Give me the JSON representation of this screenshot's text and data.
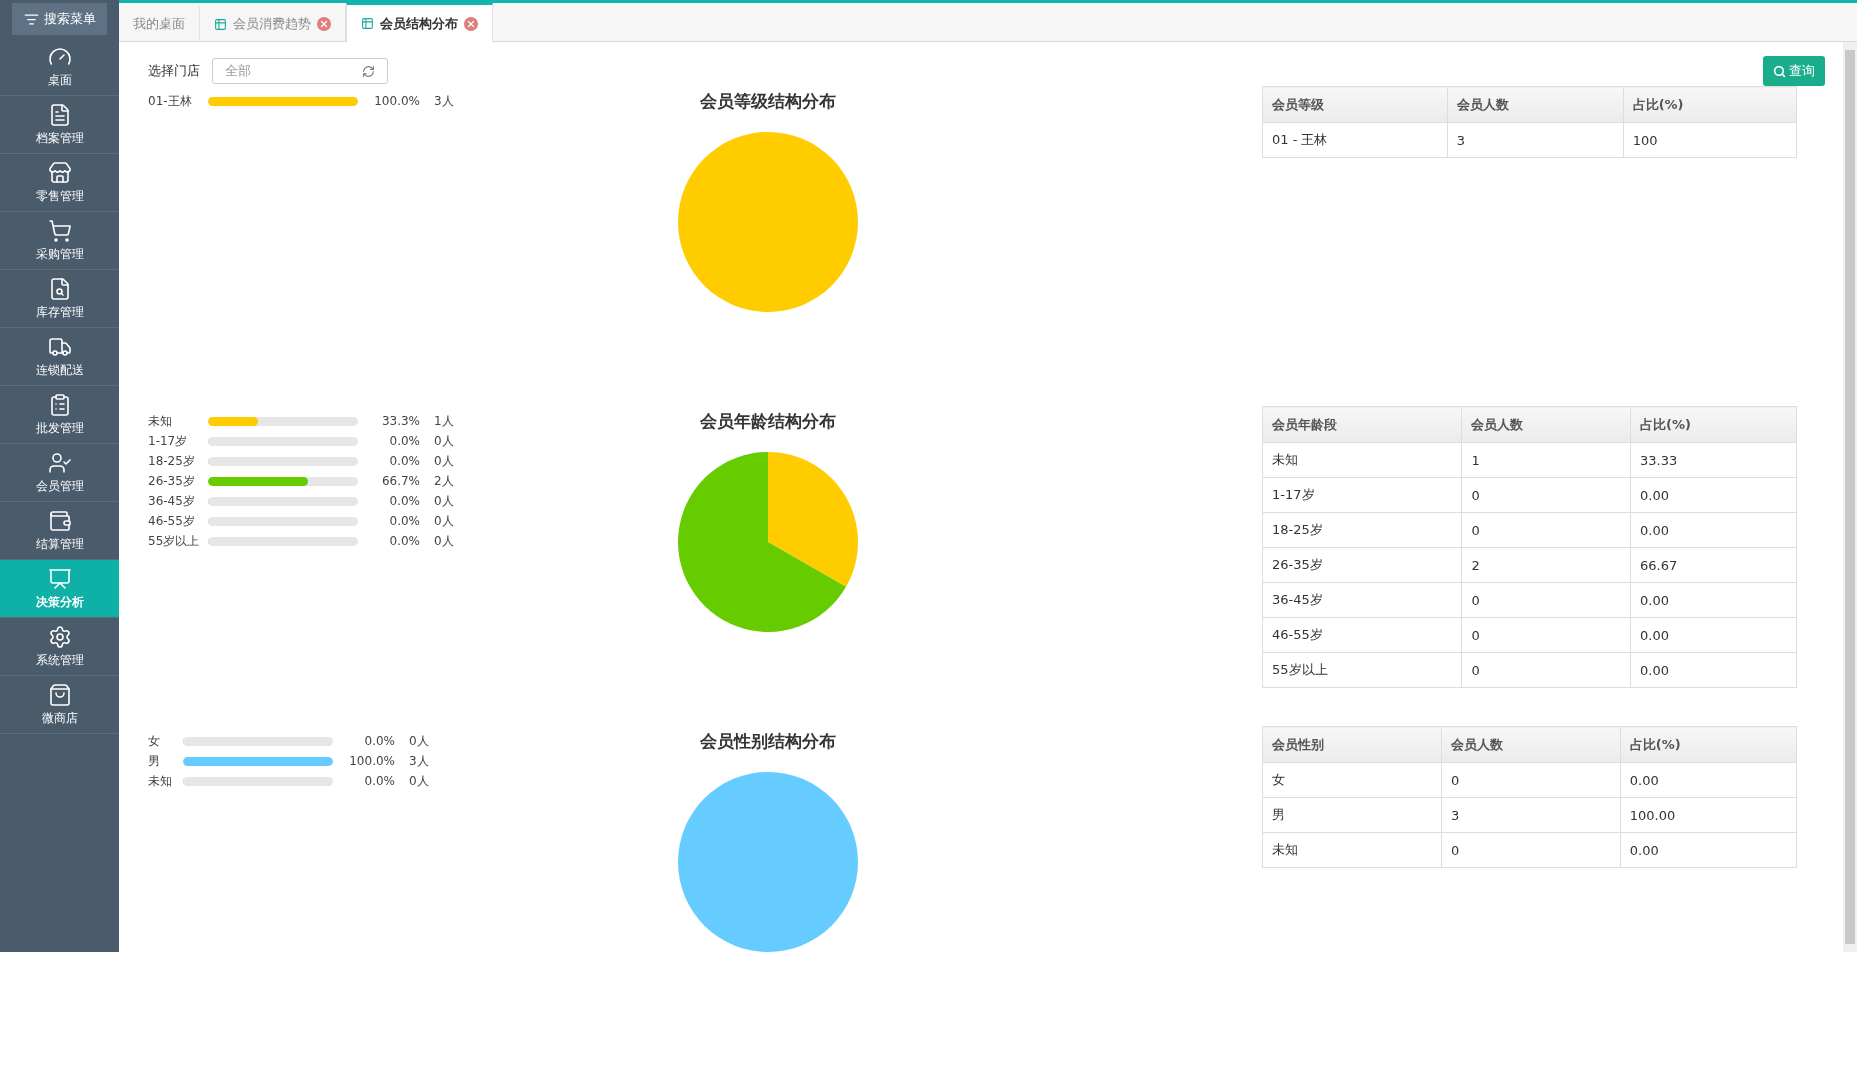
{
  "sidebar": {
    "search_button": "搜索菜单",
    "items": [
      {
        "label": "桌面",
        "selected": false
      },
      {
        "label": "档案管理",
        "selected": false
      },
      {
        "label": "零售管理",
        "selected": false
      },
      {
        "label": "采购管理",
        "selected": false
      },
      {
        "label": "库存管理",
        "selected": false
      },
      {
        "label": "连锁配送",
        "selected": false
      },
      {
        "label": "批发管理",
        "selected": false
      },
      {
        "label": "会员管理",
        "selected": false
      },
      {
        "label": "结算管理",
        "selected": false
      },
      {
        "label": "决策分析",
        "selected": true
      },
      {
        "label": "系统管理",
        "selected": false
      },
      {
        "label": "微商店",
        "selected": false
      }
    ]
  },
  "tabs": [
    {
      "label": "我的桌面",
      "selected": false,
      "closable": false
    },
    {
      "label": "会员消费趋势",
      "selected": false,
      "closable": true
    },
    {
      "label": "会员结构分布",
      "selected": true,
      "closable": true
    }
  ],
  "filter": {
    "label": "选择门店",
    "value": "全部"
  },
  "query_button": "查询",
  "sections": [
    {
      "legend": [
        {
          "label": "01-王林",
          "level": 1.0,
          "percent": "100.0%",
          "count": "3人",
          "color": "#ffcc00"
        }
      ],
      "title": "会员等级结构分布",
      "table": {
        "columns": [
          "会员等级",
          "会员人数",
          "占比(%)"
        ],
        "rows": [
          [
            "01 - 王林",
            "3",
            "100"
          ]
        ]
      }
    },
    {
      "legend": [
        {
          "label": "未知",
          "level": 0.333,
          "percent": "33.3%",
          "count": "1人",
          "color": "#ffcc00"
        },
        {
          "label": "1-17岁",
          "level": 0,
          "percent": "0.0%",
          "count": "0人"
        },
        {
          "label": "18-25岁",
          "level": 0,
          "percent": "0.0%",
          "count": "0人"
        },
        {
          "label": "26-35岁",
          "level": 0.667,
          "percent": "66.7%",
          "count": "2人",
          "color": "#66cc00"
        },
        {
          "label": "36-45岁",
          "level": 0,
          "percent": "0.0%",
          "count": "0人"
        },
        {
          "label": "46-55岁",
          "level": 0,
          "percent": "0.0%",
          "count": "0人"
        },
        {
          "label": "55岁以上",
          "level": 0,
          "percent": "0.0%",
          "count": "0人"
        }
      ],
      "title": "会员年龄结构分布",
      "table": {
        "columns": [
          "会员年龄段",
          "会员人数",
          "占比(%)"
        ],
        "rows": [
          [
            "未知",
            "1",
            "33.33"
          ],
          [
            "1-17岁",
            "0",
            "0.00"
          ],
          [
            "18-25岁",
            "0",
            "0.00"
          ],
          [
            "26-35岁",
            "2",
            "66.67"
          ],
          [
            "36-45岁",
            "0",
            "0.00"
          ],
          [
            "46-55岁",
            "0",
            "0.00"
          ],
          [
            "55岁以上",
            "0",
            "0.00"
          ]
        ]
      }
    },
    {
      "legend": [
        {
          "label": "女",
          "level": 0,
          "percent": "0.0%",
          "count": "0人"
        },
        {
          "label": "男",
          "level": 1.0,
          "percent": "100.0%",
          "count": "3人",
          "color": "#66ccff"
        },
        {
          "label": "未知",
          "level": 0,
          "percent": "0.0%",
          "count": "0人"
        }
      ],
      "title": "会员性别结构分布",
      "table": {
        "columns": [
          "会员性别",
          "会员人数",
          "占比(%)"
        ],
        "rows": [
          [
            "女",
            "0",
            "0.00"
          ],
          [
            "男",
            "3",
            "100.00"
          ],
          [
            "未知",
            "0",
            "0.00"
          ]
        ]
      }
    }
  ]
}
